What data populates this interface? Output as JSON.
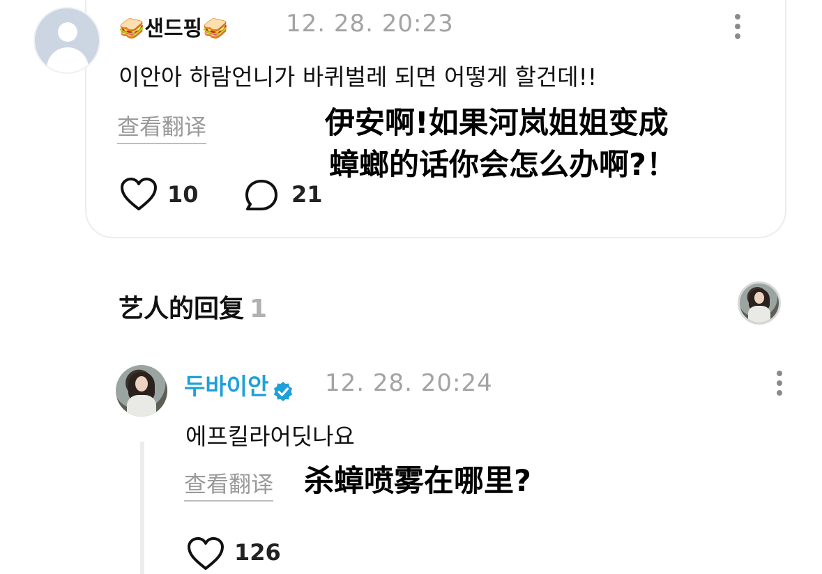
{
  "comment": {
    "username": "🥪샌드핑🥪",
    "timestamp": "12. 28. 20:23",
    "text": "이안아 하람언니가 바퀴벌레 되면 어떻게 할건데!!",
    "translate_label": "查看翻译",
    "translation_overlay_line1": "伊安啊!如果河岚姐姐变成",
    "translation_overlay_line2": "蟑螂的话你会怎么办啊?！",
    "likes": "10",
    "replies": "21"
  },
  "artist_replies": {
    "title": "艺人的回复",
    "count": "1"
  },
  "reply": {
    "username": "두바이안",
    "timestamp": "12. 28. 20:24",
    "text": "에프킬라어딧나요",
    "translate_label": "查看翻译",
    "translation_overlay": "杀蟑喷雾在哪里?",
    "likes": "126"
  },
  "colors": {
    "artist_name": "#1ea0d8",
    "verified_badge": "#1ea0d8",
    "muted": "#a3a3a3"
  },
  "icons": [
    "heart-icon",
    "comment-bubble-icon",
    "more-options-icon",
    "verified-badge-icon"
  ]
}
